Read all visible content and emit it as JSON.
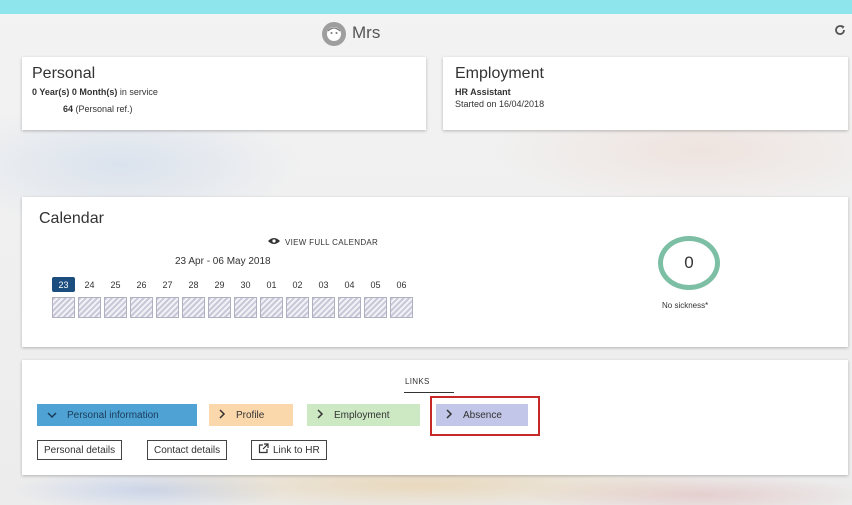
{
  "header": {
    "title": "Mrs",
    "refresh_icon": "refresh-icon",
    "avatar_icon": "face-icon"
  },
  "personal": {
    "title": "Personal",
    "years": "0 Year(s)",
    "months": "0 Month(s)",
    "service_suffix": "in service",
    "ref_number": "64",
    "ref_label": "(Personal ref.)"
  },
  "employment": {
    "title": "Employment",
    "job_title": "HR Assistant",
    "started": "Started on 16/04/2018"
  },
  "calendar": {
    "title": "Calendar",
    "view_full_label": "VIEW FULL CALENDAR",
    "range": "23 Apr - 06 May 2018",
    "days": [
      "23",
      "24",
      "25",
      "26",
      "27",
      "28",
      "29",
      "30",
      "01",
      "02",
      "03",
      "04",
      "05",
      "06"
    ],
    "today_index": 0,
    "sickness_count": "0",
    "sickness_label": "No sickness*"
  },
  "links": {
    "title": "LINKS",
    "tabs": [
      {
        "label": "Personal information",
        "icon": "chevron-down-icon",
        "color": "#4ea3d4"
      },
      {
        "label": "Profile",
        "icon": "chevron-right-icon",
        "color": "#fbd8ab"
      },
      {
        "label": "Employment",
        "icon": "chevron-right-icon",
        "color": "#cde9c4"
      },
      {
        "label": "Absence",
        "icon": "chevron-right-icon",
        "color": "#c2c6e8"
      }
    ],
    "buttons": [
      {
        "label": "Personal details"
      },
      {
        "label": "Contact details"
      },
      {
        "label": "Link to HR",
        "icon": "external-link-icon"
      }
    ]
  },
  "colors": {
    "topbar": "#8ee6ec",
    "today": "#1b4d7e",
    "ring": "#7dbfa5",
    "highlight": "#c62828"
  }
}
